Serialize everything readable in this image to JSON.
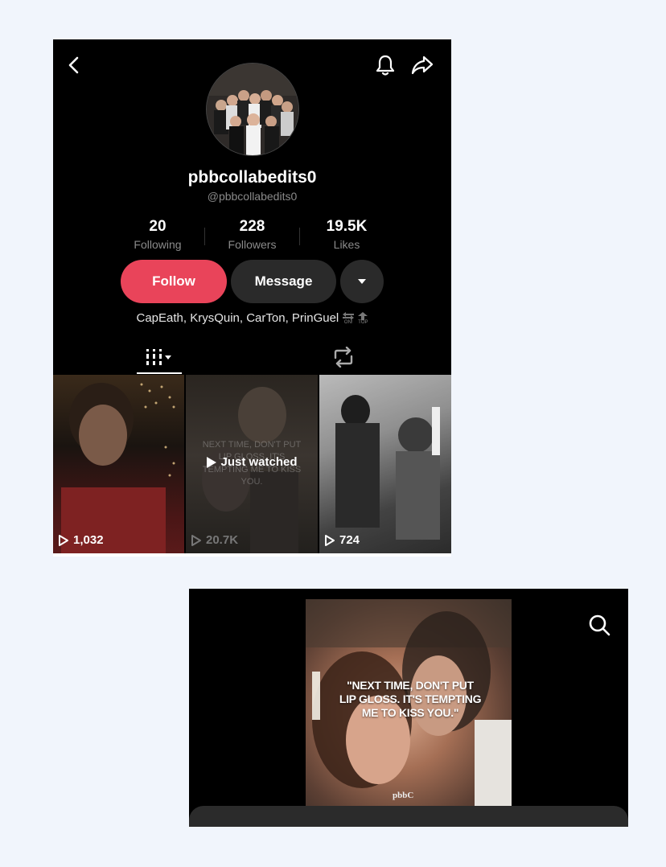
{
  "profile": {
    "display_name": "pbbcollabedits0",
    "handle": "@pbbcollabedits0",
    "stats": [
      {
        "value": "20",
        "label": "Following"
      },
      {
        "value": "228",
        "label": "Followers"
      },
      {
        "value": "19.5K",
        "label": "Likes"
      }
    ],
    "follow_label": "Follow",
    "message_label": "Message",
    "bio": "CapEath, KrysQuin, CarTon, PrinGuel",
    "bio_icons": [
      {
        "label": "ON!"
      },
      {
        "label": "TOP"
      }
    ]
  },
  "colors": {
    "follow_accent": "#e9445a",
    "background": "#000000",
    "page_bg": "#f1f5fc"
  },
  "videos": [
    {
      "views": "1,032",
      "overlay": ""
    },
    {
      "views": "20.7K",
      "overlay": "Just watched",
      "caption": "NEXT TIME, DON'T PUT LIP GLOSS. IT'S TEMPTING ME TO KISS YOU."
    },
    {
      "views": "724",
      "overlay": ""
    }
  ],
  "player": {
    "quote": "\"NEXT TIME, DON'T PUT LIP GLOSS. IT'S TEMPTING ME TO KISS YOU.\"",
    "watermark": "pbbC"
  }
}
